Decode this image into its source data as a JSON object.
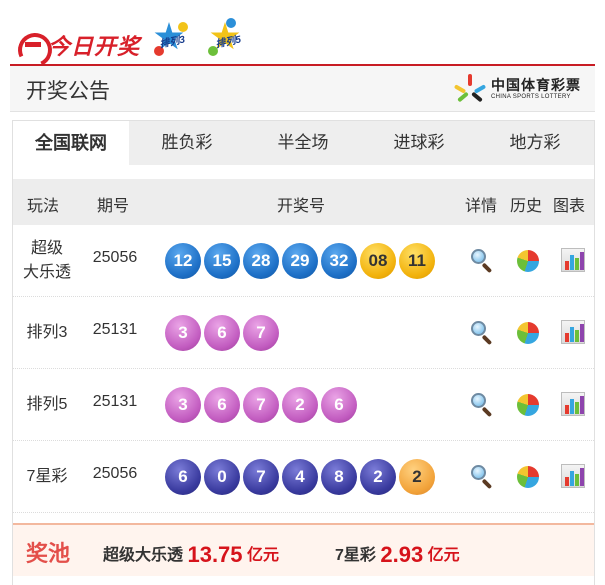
{
  "brand": {
    "site_logo": "今日开奖",
    "game_badges": [
      "排列3",
      "排列5"
    ]
  },
  "header": {
    "title": "开奖公告",
    "org_name": "中国体育彩票",
    "org_name_en": "CHINA SPORTS LOTTERY"
  },
  "tabs": [
    {
      "label": "全国联网",
      "active": true
    },
    {
      "label": "胜负彩",
      "active": false
    },
    {
      "label": "半全场",
      "active": false
    },
    {
      "label": "进球彩",
      "active": false
    },
    {
      "label": "地方彩",
      "active": false
    }
  ],
  "columns": {
    "game": "玩法",
    "issue": "期号",
    "numbers": "开奖号",
    "detail": "详情",
    "history": "历史",
    "chart": "图表"
  },
  "rows": [
    {
      "name_line1": "超级",
      "name_line2": "大乐透",
      "issue": "25056",
      "balls": [
        {
          "n": "12",
          "c": "blue"
        },
        {
          "n": "15",
          "c": "blue"
        },
        {
          "n": "28",
          "c": "blue"
        },
        {
          "n": "29",
          "c": "blue"
        },
        {
          "n": "32",
          "c": "blue"
        },
        {
          "n": "08",
          "c": "yellow"
        },
        {
          "n": "11",
          "c": "yellow"
        }
      ]
    },
    {
      "name_line1": "排列3",
      "name_line2": "",
      "issue": "25131",
      "balls": [
        {
          "n": "3",
          "c": "pink"
        },
        {
          "n": "6",
          "c": "pink"
        },
        {
          "n": "7",
          "c": "pink"
        }
      ]
    },
    {
      "name_line1": "排列5",
      "name_line2": "",
      "issue": "25131",
      "balls": [
        {
          "n": "3",
          "c": "pink"
        },
        {
          "n": "6",
          "c": "pink"
        },
        {
          "n": "7",
          "c": "pink"
        },
        {
          "n": "2",
          "c": "pink"
        },
        {
          "n": "6",
          "c": "pink"
        }
      ]
    },
    {
      "name_line1": "7星彩",
      "name_line2": "",
      "issue": "25056",
      "balls": [
        {
          "n": "6",
          "c": "navy"
        },
        {
          "n": "0",
          "c": "navy"
        },
        {
          "n": "7",
          "c": "navy"
        },
        {
          "n": "4",
          "c": "navy"
        },
        {
          "n": "8",
          "c": "navy"
        },
        {
          "n": "2",
          "c": "navy"
        },
        {
          "n": "2",
          "c": "orange"
        }
      ]
    }
  ],
  "pool": {
    "label": "奖池",
    "items": [
      {
        "game": "超级大乐透",
        "amount": "13.75",
        "unit": "亿元"
      },
      {
        "game": "7星彩",
        "amount": "2.93",
        "unit": "亿元"
      }
    ]
  },
  "icons": {
    "detail": "magnifier-icon",
    "history": "pie-chart-icon",
    "chart": "bar-chart-icon"
  },
  "colors": {
    "brand_red": "#d8202a",
    "front_ball": "#1d6fc6",
    "back_ball": "#f2b20c",
    "pailie_ball": "#c25cc0",
    "qxc_ball": "#393a9e",
    "qxc_special": "#f2a33a",
    "pool_amount": "#d6131b"
  }
}
